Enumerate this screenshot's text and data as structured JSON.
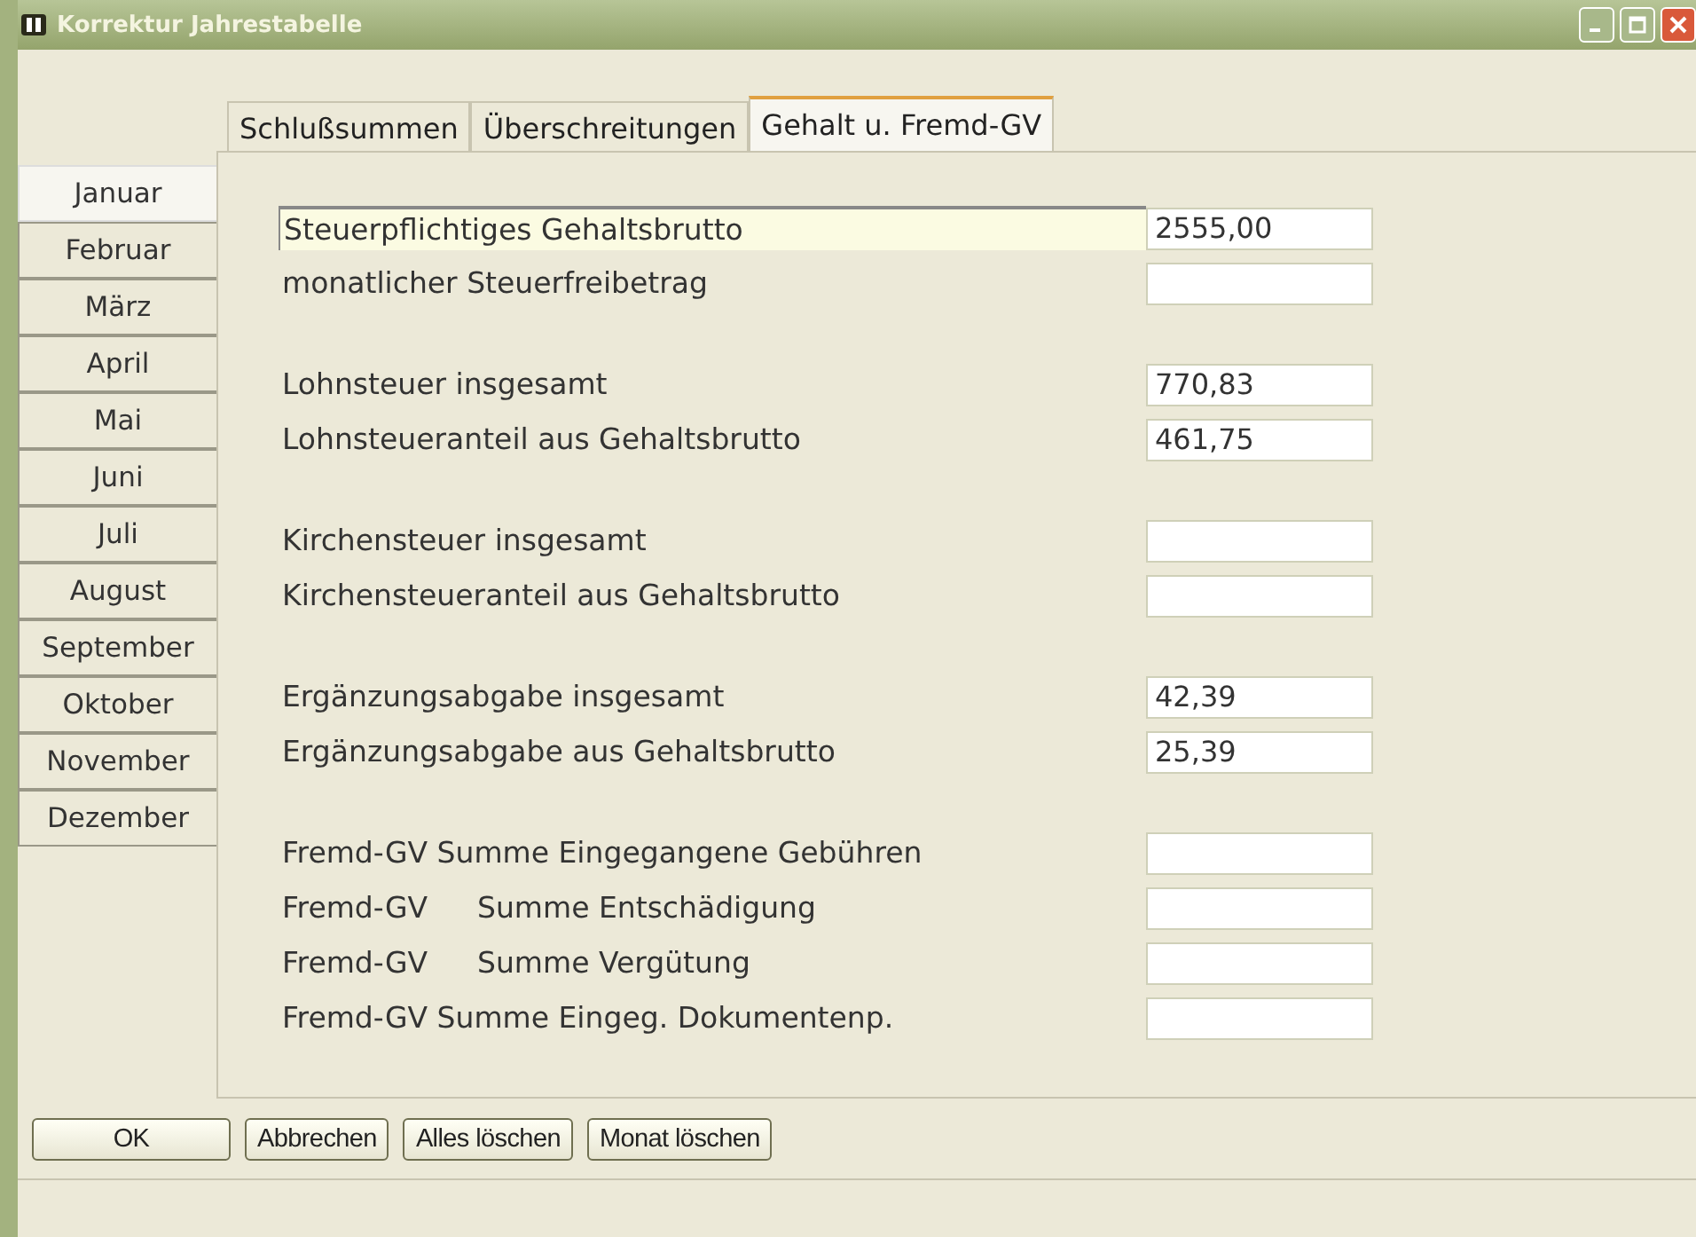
{
  "window": {
    "title": "Korrektur Jahrestabelle"
  },
  "tabs": [
    {
      "label": "Schlußsummen",
      "selected": false
    },
    {
      "label": "Überschreitungen",
      "selected": false
    },
    {
      "label": "Gehalt u. Fremd-GV",
      "selected": true
    }
  ],
  "months": [
    {
      "label": "Januar",
      "selected": true
    },
    {
      "label": "Februar",
      "selected": false
    },
    {
      "label": "März",
      "selected": false
    },
    {
      "label": "April",
      "selected": false
    },
    {
      "label": "Mai",
      "selected": false
    },
    {
      "label": "Juni",
      "selected": false
    },
    {
      "label": "Juli",
      "selected": false
    },
    {
      "label": "August",
      "selected": false
    },
    {
      "label": "September",
      "selected": false
    },
    {
      "label": "Oktober",
      "selected": false
    },
    {
      "label": "November",
      "selected": false
    },
    {
      "label": "Dezember",
      "selected": false
    }
  ],
  "groups": [
    {
      "rows": [
        {
          "label": "Steuerpflichtiges Gehaltsbrutto",
          "value": "2555,00",
          "focused": true
        },
        {
          "label": "monatlicher Steuerfreibetrag",
          "focused": false
        }
      ]
    },
    {
      "rows": [
        {
          "label": "Lohnsteuer insgesamt",
          "value": "770,83",
          "focused": false
        },
        {
          "label": "Lohnsteueranteil aus Gehaltsbrutto",
          "value": "461,75",
          "focused": false
        }
      ]
    },
    {
      "rows": [
        {
          "label": "Kirchensteuer insgesamt",
          "focused": false
        },
        {
          "label": "Kirchensteueranteil aus Gehaltsbrutto",
          "focused": false
        }
      ]
    },
    {
      "rows": [
        {
          "label": "Ergänzungsabgabe insgesamt",
          "value": "42,39",
          "focused": false
        },
        {
          "label": "Ergänzungsabgabe aus Gehaltsbrutto",
          "value": "25,39",
          "focused": false
        }
      ]
    },
    {
      "rows": [
        {
          "label": "Fremd-GV Summe Eingegangene Gebühren",
          "focused": false
        },
        {
          "label": "Fremd-GV",
          "detail": "Summe Entschädigung",
          "focused": false
        },
        {
          "label": "Fremd-GV",
          "detail": "Summe Vergütung",
          "focused": false
        },
        {
          "label": "Fremd-GV Summe Eingeg. Dokumentenp.",
          "focused": false
        }
      ]
    }
  ],
  "buttons": [
    "OK",
    "Abbrechen",
    "Alles löschen",
    "Monat löschen"
  ]
}
